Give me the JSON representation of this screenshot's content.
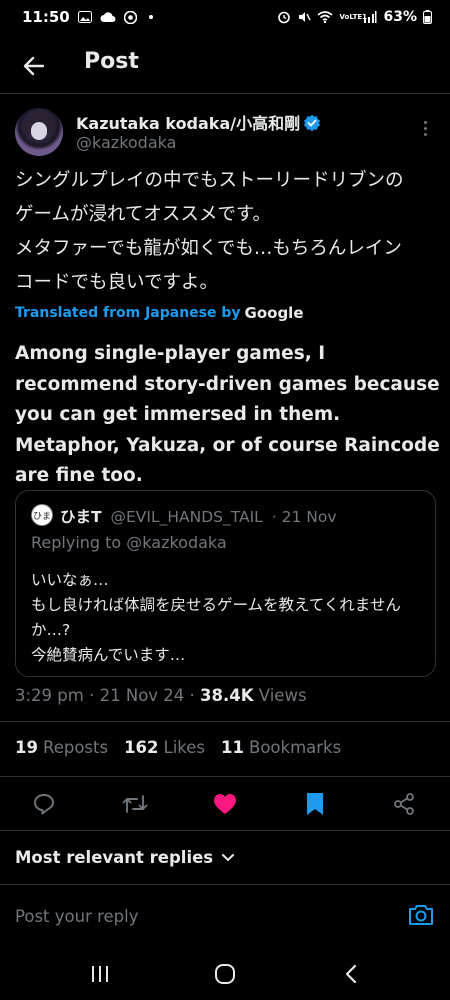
{
  "status_bar": {
    "time": "11:50",
    "battery": "63%",
    "network": "VoLTE1"
  },
  "header": {
    "title": "Post"
  },
  "post": {
    "author_name": "Kazutaka kodaka/小高和剛",
    "author_handle": "@kazkodaka",
    "text": "シングルプレイの中でもストーリードリブンの\nゲームが浸れてオススメです。\nメタファーでも龍が如くでも…もちろんレイン\nコードでも良いですよ。",
    "translated_label": "Translated from Japanese by",
    "translator": "Google",
    "translation": "Among single-player games, I recommend story-driven games because you can get immersed in them. Metaphor, Yakuza, or of course Raincode are fine too."
  },
  "quote": {
    "name": "ひまT",
    "handle": "@EVIL_HANDS_TAIL",
    "date": "· 21 Nov",
    "replying_to": "Replying to @kazkodaka",
    "text": "いいなぁ…\nもし良ければ体調を戻せるゲームを教えてくれませんか…?\n今絶賛病んでいます…",
    "avatar_text": "ひま"
  },
  "meta": {
    "time": "3:29 pm",
    "date": "21 Nov 24",
    "views_count": "38.4K",
    "views_label": "Views"
  },
  "stats": {
    "reposts_count": "19",
    "reposts_label": "Reposts",
    "likes_count": "162",
    "likes_label": "Likes",
    "bookmarks_count": "11",
    "bookmarks_label": "Bookmarks"
  },
  "replies": {
    "sort_label": "Most relevant replies"
  },
  "reply_bar": {
    "placeholder": "Post your reply"
  },
  "colors": {
    "accent": "#1d9bf0",
    "like": "#f91880",
    "muted": "#71767b",
    "text": "#e7e9ea",
    "background": "#000000"
  },
  "icons": [
    "back-arrow-icon",
    "verified-badge-icon",
    "more-icon",
    "reply-icon",
    "repost-icon",
    "like-icon",
    "bookmark-icon",
    "share-icon",
    "chevron-down-icon",
    "camera-icon",
    "recents-icon",
    "home-icon",
    "back-icon"
  ]
}
